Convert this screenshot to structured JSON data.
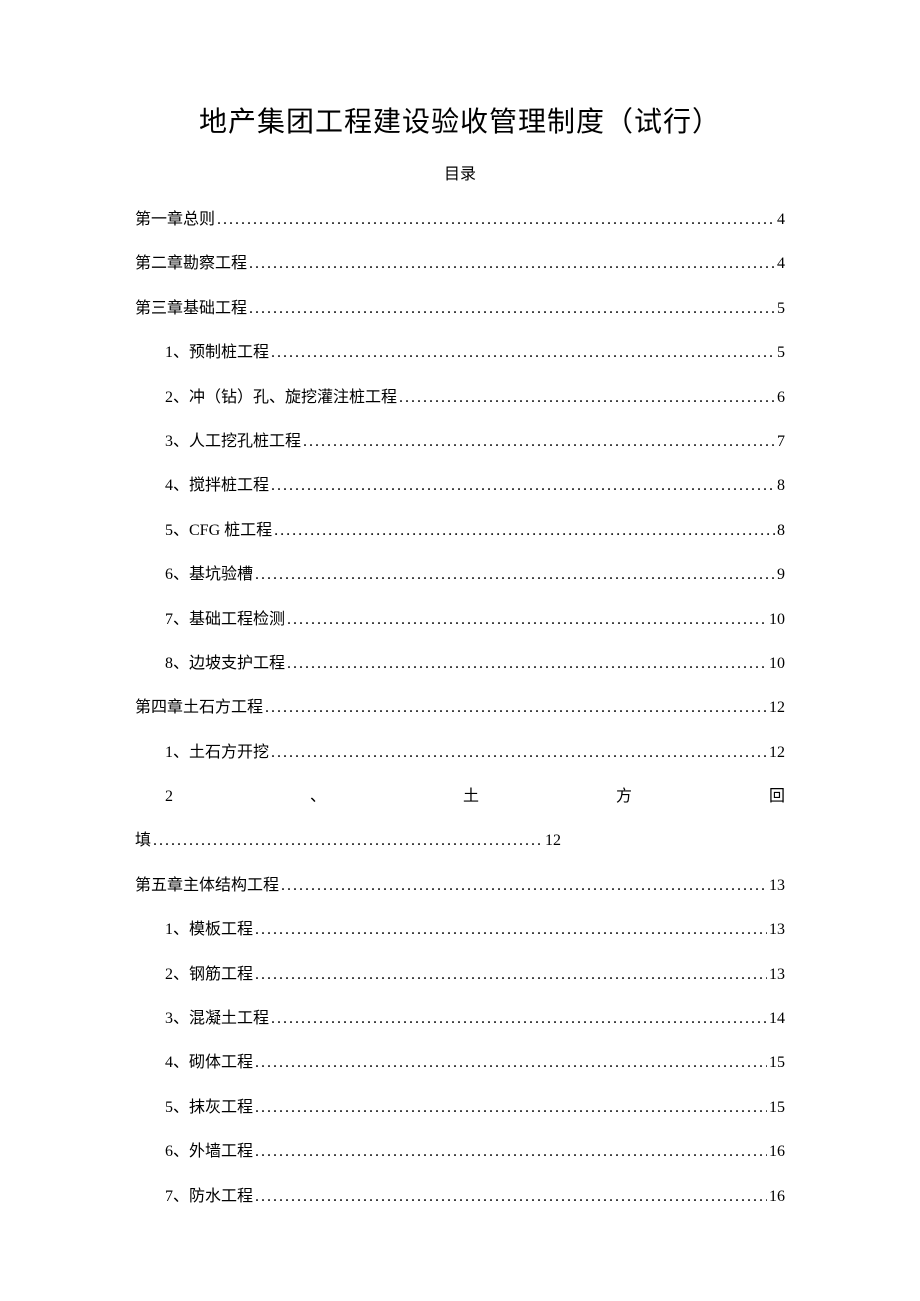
{
  "title": "地产集团工程建设验收管理制度（试行）",
  "subtitle": "目录",
  "toc": [
    {
      "level": 0,
      "label": "第一章总则",
      "page": "4"
    },
    {
      "level": 0,
      "label": "第二章勘察工程",
      "page": "4"
    },
    {
      "level": 0,
      "label": "第三章基础工程",
      "page": "5"
    },
    {
      "level": 1,
      "label": "1、预制桩工程",
      "page": "5"
    },
    {
      "level": 1,
      "label": "2、冲（钻）孔、旋挖灌注桩工程",
      "page": "6"
    },
    {
      "level": 1,
      "label": "3、人工挖孔桩工程",
      "page": "7"
    },
    {
      "level": 1,
      "label": "4、搅拌桩工程",
      "page": "8"
    },
    {
      "level": 1,
      "label": "5、CFG 桩工程",
      "page": "8"
    },
    {
      "level": 1,
      "label": "6、基坑验槽",
      "page": "9"
    },
    {
      "level": 1,
      "label": "7、基础工程检测",
      "page": "10"
    },
    {
      "level": 1,
      "label": "8、边坡支护工程",
      "page": "10"
    },
    {
      "level": 0,
      "label": "第四章土石方工程",
      "page": "12"
    },
    {
      "level": 1,
      "label": "1、土石方开挖",
      "page": "12"
    }
  ],
  "toc_special": {
    "line1_parts": [
      "2",
      "、",
      "土",
      "方",
      "回"
    ],
    "line2_label": "填",
    "line2_page": "12"
  },
  "toc_after": [
    {
      "level": 0,
      "label": "第五章主体结构工程",
      "page": "13"
    },
    {
      "level": 1,
      "label": "1、模板工程",
      "page": "13"
    },
    {
      "level": 1,
      "label": "2、钢筋工程",
      "page": "13"
    },
    {
      "level": 1,
      "label": "3、混凝土工程",
      "page": "14"
    },
    {
      "level": 1,
      "label": "4、砌体工程",
      "page": "15"
    },
    {
      "level": 1,
      "label": "5、抹灰工程",
      "page": "15"
    },
    {
      "level": 1,
      "label": "6、外墙工程",
      "page": "16"
    },
    {
      "level": 1,
      "label": "7、防水工程",
      "page": "16"
    }
  ]
}
